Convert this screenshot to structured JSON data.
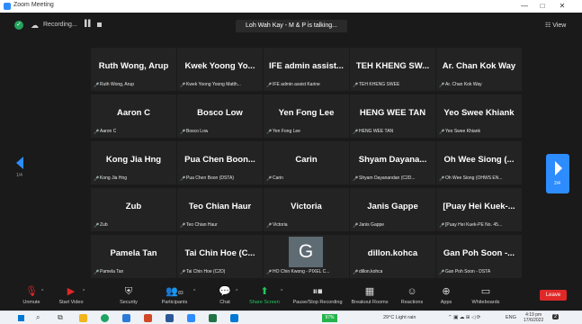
{
  "window": {
    "title": "Zoom Meeting",
    "controls": [
      "—",
      "□",
      "✕"
    ]
  },
  "topbar": {
    "recording_label": "Recording...",
    "talking_text": "Loh Wah Kay - M & P is talking...",
    "view_label": "View"
  },
  "gallery": {
    "page_left": "1/4",
    "page_right": "2/4",
    "participants": [
      {
        "name": "Ruth Wong, Arup",
        "subtitle": "Ruth Wong, Arup"
      },
      {
        "name": "Kwek Yoong Yo...",
        "subtitle": "Kwek Yoong Yoong Matth..."
      },
      {
        "name": "IFE admin assist...",
        "subtitle": "IFE admin assist Karine"
      },
      {
        "name": "TEH KHENG SW...",
        "subtitle": "TEH KHENG SWEE"
      },
      {
        "name": "Ar. Chan Kok Way",
        "subtitle": "Ar. Chan Kok Way"
      },
      {
        "name": "Aaron C",
        "subtitle": "Aaron C"
      },
      {
        "name": "Bosco Low",
        "subtitle": "Bosco Low"
      },
      {
        "name": "Yen Fong Lee",
        "subtitle": "Yen Fong Lee"
      },
      {
        "name": "HENG WEE TAN",
        "subtitle": "HENG WEE TAN"
      },
      {
        "name": "Yeo Swee Khiank",
        "subtitle": "Yeo Swee Khiank"
      },
      {
        "name": "Kong Jia Hng",
        "subtitle": "Kong Jia Hng"
      },
      {
        "name": "Pua Chen Boon...",
        "subtitle": "Pua Chen Boon (DSTA)"
      },
      {
        "name": "Carin",
        "subtitle": "Carin"
      },
      {
        "name": "Shyam Dayana...",
        "subtitle": "Shyam Dayanandan (C2D..."
      },
      {
        "name": "Oh Wee Siong (...",
        "subtitle": "Oh Wee Siong (OHWS EN..."
      },
      {
        "name": "Zub",
        "subtitle": "Zub"
      },
      {
        "name": "Teo Chian Haur",
        "subtitle": "Teo Chian Haur"
      },
      {
        "name": "Victoria",
        "subtitle": "Victoria"
      },
      {
        "name": "Janis Gappe",
        "subtitle": "Janis Gappe"
      },
      {
        "name": "[Puay Hei Kuek-...",
        "subtitle": "[Puay Hei Kuek-PE No. 45..."
      },
      {
        "name": "Pamela Tan",
        "subtitle": "Pamela Tan"
      },
      {
        "name": "Tai Chin Hoe (C...",
        "subtitle": "Tai Chin Hoe (C2D)"
      },
      {
        "name": "G",
        "subtitle": "HO Chin Kwong - PIXEL C..."
      },
      {
        "name": "dillon.kohca",
        "subtitle": "dillon.kohca"
      },
      {
        "name": "Gan Poh Soon -...",
        "subtitle": "Gan Poh Soon - DSTA"
      }
    ]
  },
  "toolbar": {
    "unmute": "Unmute",
    "start_video": "Start Video",
    "security": "Security",
    "participants": "Participants",
    "participants_count": "83",
    "chat": "Chat",
    "share_screen": "Share Screen",
    "pause_recording": "Pause/Stop Recording",
    "breakout_rooms": "Breakout Rooms",
    "reactions": "Reactions",
    "apps": "Apps",
    "whiteboards": "Whiteboards",
    "leave": "Leave"
  },
  "taskbar": {
    "battery": "97%",
    "weather": "29°C  Light rain",
    "language": "ENG",
    "time": "4:19 pm",
    "date": "17/6/2022",
    "notifications": "2"
  },
  "colors": {
    "meeting_bg": "#1a1a1a",
    "tile_bg": "#232323",
    "accent_blue": "#2d8cff",
    "muted_red": "#e02828",
    "share_green": "#23c55e",
    "avatar_bg": "#5f6b73"
  }
}
